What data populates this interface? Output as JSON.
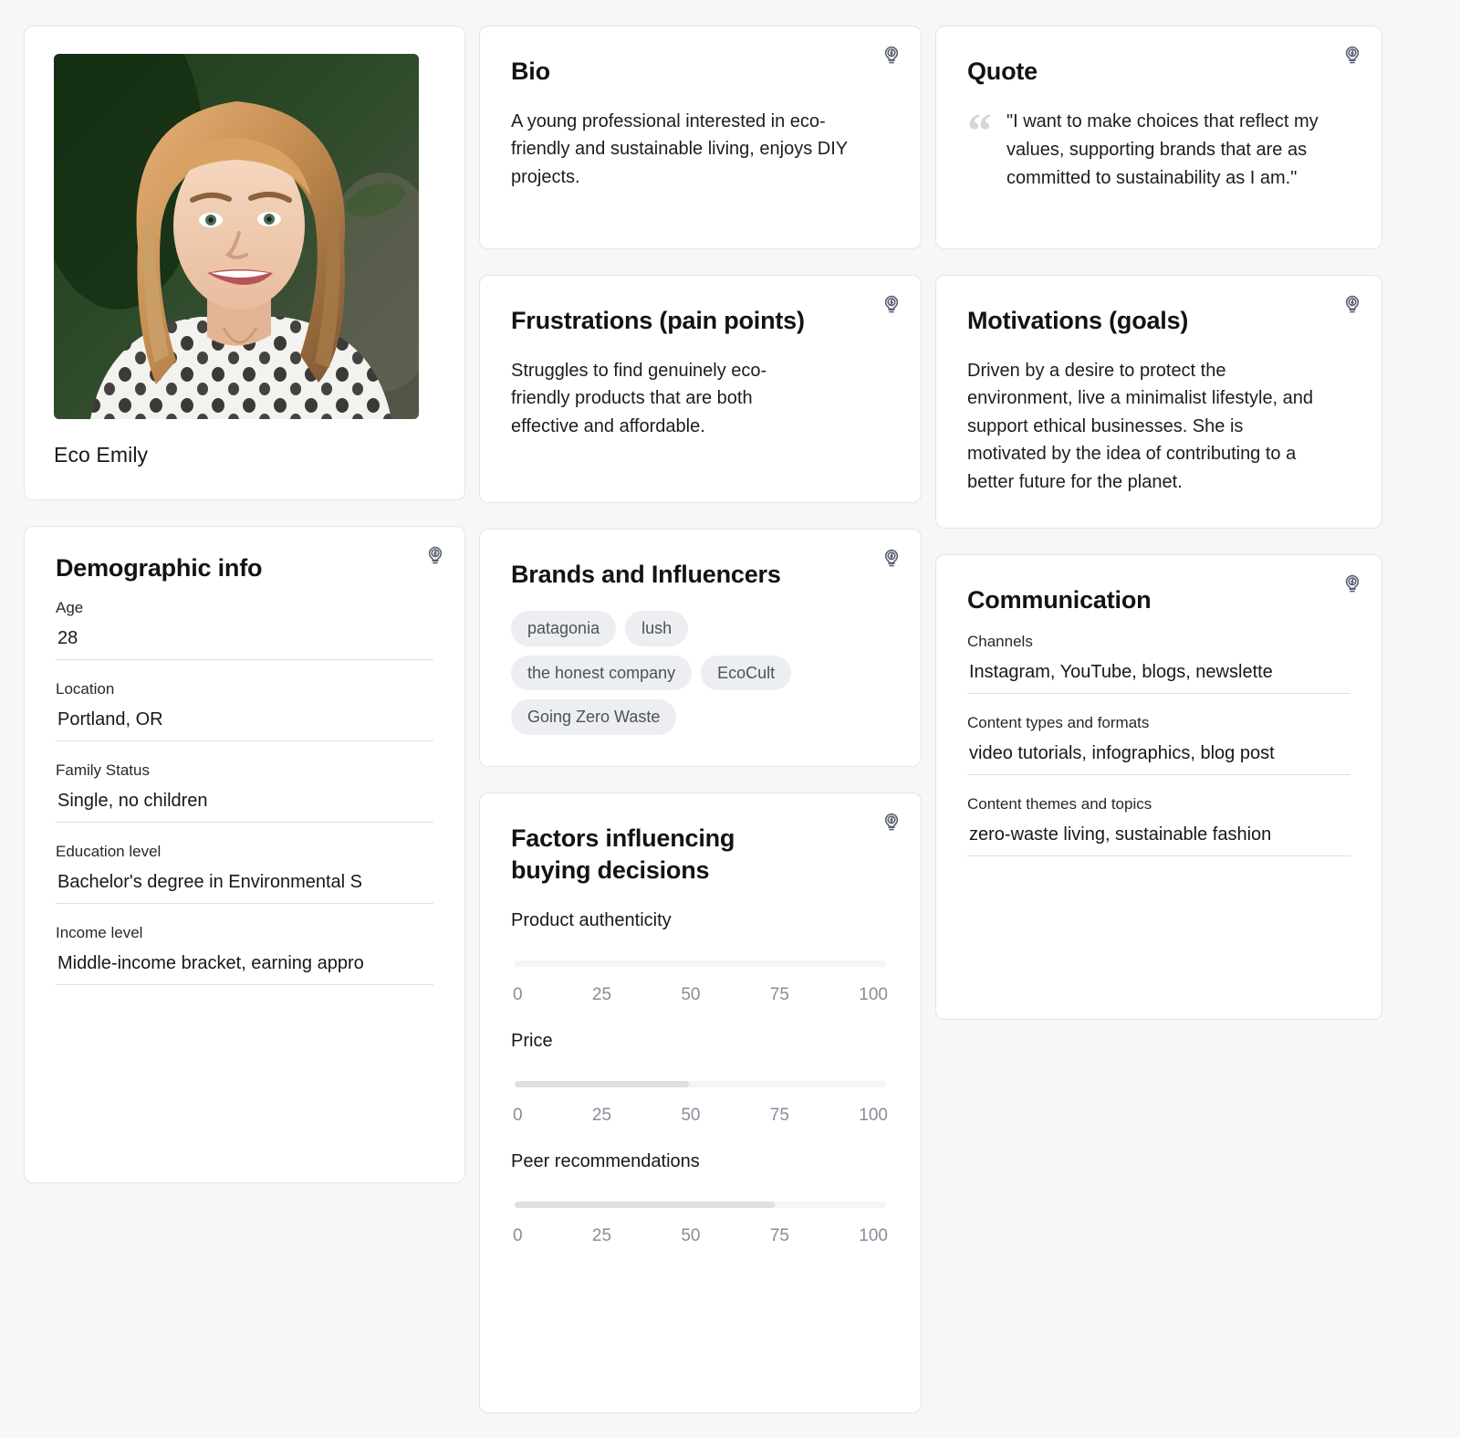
{
  "icons": {
    "suggest": "lightbulb-bolt-icon",
    "quote": "quote-mark-icon"
  },
  "profile": {
    "name": "Eco Emily",
    "avatar_alt": "portrait-photo"
  },
  "bio": {
    "title": "Bio",
    "text": "A young professional interested in eco-friendly and sustainable living, enjoys DIY projects."
  },
  "quote": {
    "title": "Quote",
    "mark": "“",
    "text": "\"I want to make choices that reflect my values, supporting brands that are as committed to sustainability as I am.\""
  },
  "frustrations": {
    "title": "Frustrations (pain points)",
    "text": "Struggles to find genuinely eco-friendly products that are both effective and affordable."
  },
  "motivations": {
    "title": "Motivations (goals)",
    "text": "Driven by a desire to protect the environment, live a minimalist lifestyle, and support ethical businesses. She is motivated by the idea of contributing to a better future for the planet."
  },
  "demographic": {
    "title": "Demographic info",
    "fields": [
      {
        "label": "Age",
        "value": "28"
      },
      {
        "label": "Location",
        "value": "Portland, OR"
      },
      {
        "label": "Family Status",
        "value": "Single, no children"
      },
      {
        "label": "Education level",
        "value": "Bachelor's degree in Environmental S"
      },
      {
        "label": "Income level",
        "value": "Middle-income bracket, earning appro"
      }
    ]
  },
  "brands": {
    "title": "Brands and Influencers",
    "chips": [
      "patagonia",
      "lush",
      "the honest company",
      "EcoCult",
      "Going Zero Waste"
    ]
  },
  "factors": {
    "title": "Factors influencing buying decisions",
    "ticks": [
      "0",
      "25",
      "50",
      "75",
      "100"
    ],
    "sliders": [
      {
        "label": "Product authenticity",
        "value": 0
      },
      {
        "label": "Price",
        "value": 47
      },
      {
        "label": "Peer recommendations",
        "value": 70
      }
    ]
  },
  "communication": {
    "title": "Communication",
    "fields": [
      {
        "label": "Channels",
        "value": "Instagram, YouTube, blogs, newslette"
      },
      {
        "label": "Content types and formats",
        "value": "video tutorials, infographics, blog post"
      },
      {
        "label": "Content themes and topics",
        "value": "zero-waste living, sustainable fashion"
      }
    ]
  },
  "chart_data": {
    "type": "bar",
    "title": "Factors influencing buying decisions",
    "categories": [
      "Product authenticity",
      "Price",
      "Peer recommendations"
    ],
    "values": [
      0,
      47,
      70
    ],
    "xlabel": "",
    "ylabel": "",
    "ylim": [
      0,
      100
    ],
    "tick_labels": [
      "0",
      "25",
      "50",
      "75",
      "100"
    ]
  },
  "colors": {
    "page_background": "#f6f7f9",
    "card_background": "#ffffff",
    "card_border": "#e3e5e8",
    "text_primary": "#15181c",
    "text_secondary": "#5a6072",
    "chip_background": "#eceef1",
    "chip_text": "#4c525c",
    "slider_track": "#f3f4f6",
    "slider_fill": "#dddfe3",
    "tick_text": "#878d98"
  }
}
